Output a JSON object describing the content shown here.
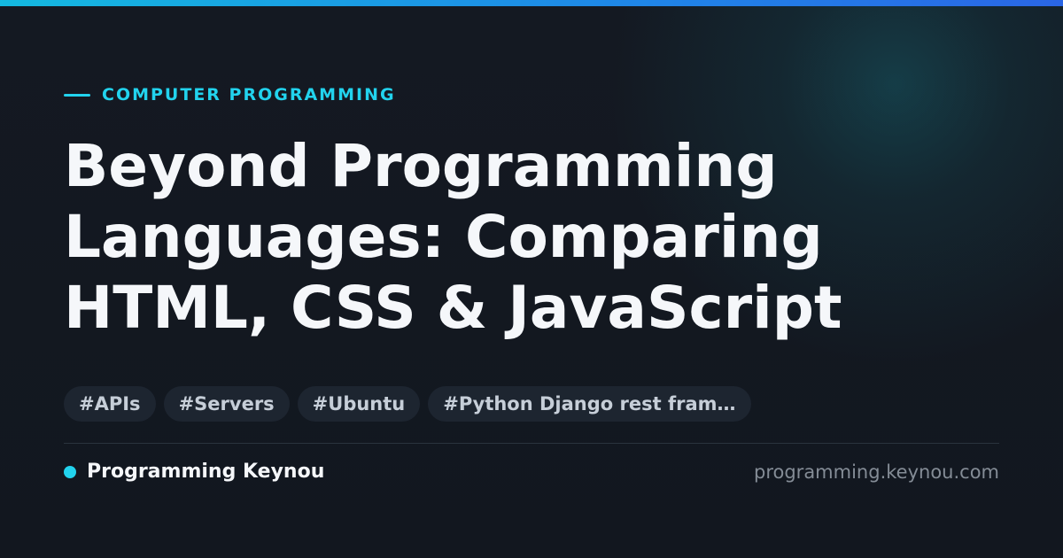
{
  "colors": {
    "accent": "#22d3ee",
    "background": "#141922",
    "title": "#f5f7fa",
    "tag_background": "#1d2530",
    "tag_text": "#c6ced8",
    "url_text": "#848c96"
  },
  "category": {
    "label": "COMPUTER PROGRAMMING"
  },
  "title": {
    "lines": [
      "Beyond Programming",
      "Languages: Comparing",
      "HTML, CSS & JavaScript"
    ]
  },
  "tags": [
    "#APIs",
    "#Servers",
    "#Ubuntu",
    "#Python Django rest fram…"
  ],
  "footer": {
    "brand_name": "Programming Keynou",
    "site_url": "programming.keynou.com"
  }
}
